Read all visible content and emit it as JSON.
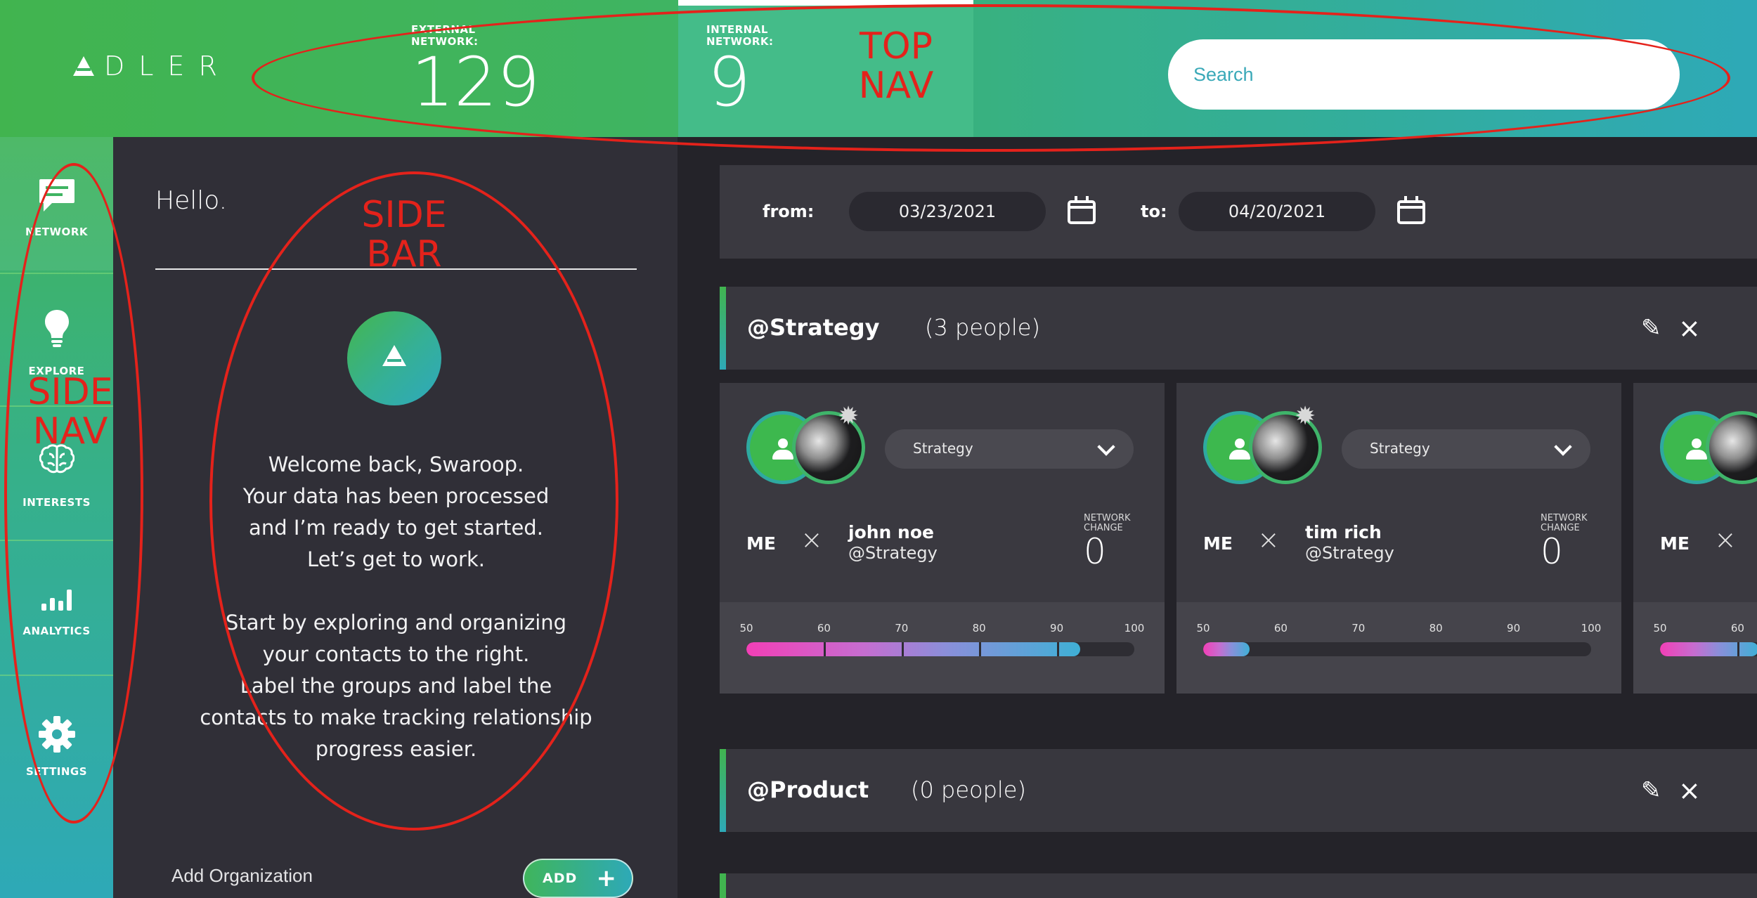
{
  "topnav": {
    "logo_text": "DLER",
    "external_label": "EXTERNAL NETWORK:",
    "external_value": "129",
    "internal_label": "INTERNAL NETWORK:",
    "internal_value": "9",
    "search_placeholder": "Search"
  },
  "sidenav": {
    "items": [
      {
        "label": "NETWORK",
        "icon": "chat-icon"
      },
      {
        "label": "EXPLORE",
        "icon": "lightbulb-icon"
      },
      {
        "label": "INTERESTS",
        "icon": "brain-icon"
      },
      {
        "label": "ANALYTICS",
        "icon": "bar-chart-icon"
      },
      {
        "label": "SETTINGS",
        "icon": "gear-icon"
      }
    ]
  },
  "sidebar": {
    "greeting": "Hello.",
    "message_1": [
      "Welcome back, Swaroop.",
      "Your data has been processed",
      "and I’m ready to get started.",
      "Let’s get to work."
    ],
    "message_2": [
      "Start by exploring and organizing",
      "your contacts to the right.",
      "Label the groups and label the",
      "contacts to make tracking relationship",
      "progress easier."
    ],
    "add_org_label": "Add Organization",
    "add_button_label": "ADD",
    "add_button_icon": "+"
  },
  "main": {
    "from_label": "from:",
    "from_date": "03/23/2021",
    "to_label": "to:",
    "to_date": "04/20/2021",
    "groups": [
      {
        "name": "@Strategy",
        "count": "(3 people)"
      },
      {
        "name": "@Product",
        "count": "(0 people)"
      }
    ],
    "cards": [
      {
        "select": "Strategy",
        "me": "ME",
        "name": "john noe",
        "handle": "@Strategy",
        "nc_label": "NETWORK CHANGE",
        "nc_value": "0",
        "score": 93
      },
      {
        "select": "Strategy",
        "me": "ME",
        "name": "tim rich",
        "handle": "@Strategy",
        "nc_label": "NETWORK CHANGE",
        "nc_value": "0",
        "score": 56
      },
      {
        "me": "ME"
      }
    ],
    "ticks": [
      "50",
      "60",
      "70",
      "80",
      "90",
      "100"
    ],
    "partial_ticks": [
      "50",
      "60"
    ]
  },
  "annotations": {
    "top_nav": "TOP NAV",
    "side_bar": "SIDE BAR",
    "side_nav": "SIDE NAV",
    "color": "#e4221b"
  }
}
